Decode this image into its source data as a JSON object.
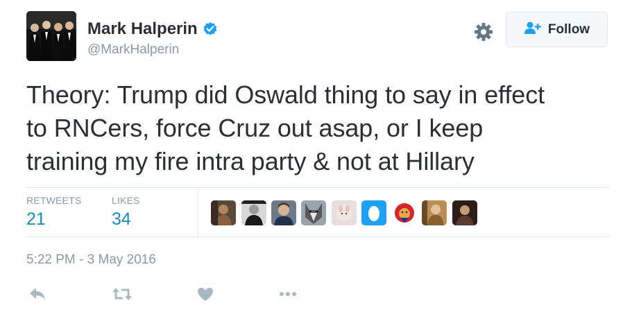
{
  "user": {
    "display_name": "Mark Halperin",
    "handle": "@MarkHalperin",
    "verified": true
  },
  "follow_button": {
    "label": "Follow",
    "icon": "add-user-icon"
  },
  "settings_icon": "gear-icon",
  "tweet": {
    "text_lines": [
      "Theory: Trump did Oswald thing to say in effect",
      "to RNCers, force Cruz out asap, or I keep",
      "training my fire intra party & not at Hillary"
    ],
    "timestamp": "5:22 PM - 3 May 2016"
  },
  "stats": {
    "retweets_label": "RETWEETS",
    "retweets_count": "21",
    "likes_label": "LIKES",
    "likes_count": "34"
  },
  "likers": [
    "liker-avatar-1",
    "liker-avatar-2",
    "liker-avatar-3",
    "liker-avatar-4",
    "liker-avatar-5",
    "liker-avatar-6",
    "liker-avatar-7",
    "liker-avatar-8",
    "liker-avatar-9"
  ],
  "actions": [
    "reply-icon",
    "retweet-icon",
    "like-icon",
    "more-icon"
  ],
  "colors": {
    "accent": "#1da1f2",
    "count_blue": "#1a8bb9",
    "muted": "#8899a6",
    "text": "#292f33",
    "divider": "#e1e8ed"
  }
}
